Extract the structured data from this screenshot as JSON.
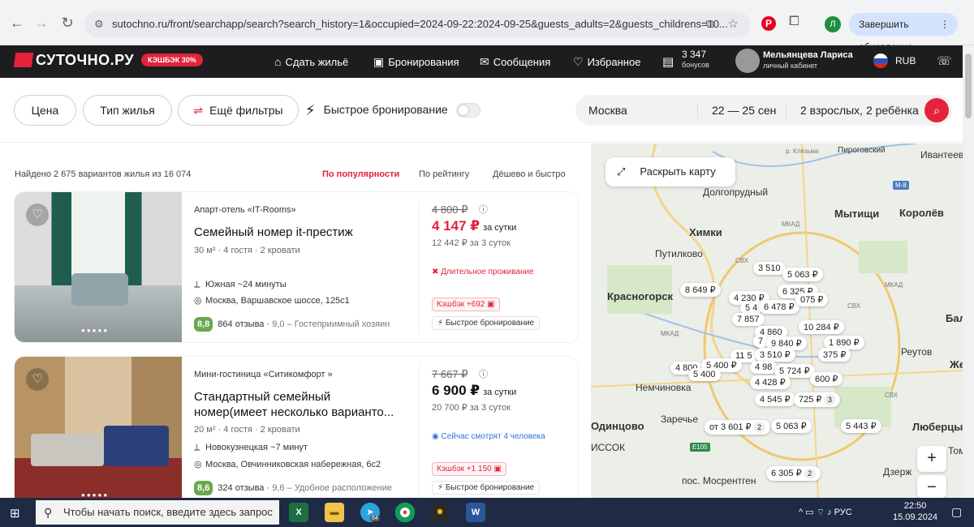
{
  "browser": {
    "url": "sutochno.ru/front/searchapp/search?search_history=1&occupied=2024-09-22:2024-09-25&guests_adults=2&guests_childrens=10...",
    "profile_initial": "Л",
    "update_label": "Завершить обновление"
  },
  "header": {
    "logo": "СУТОЧНО.РУ",
    "cashback_badge": "КЭШБЭК 30%",
    "nav": [
      {
        "label": "Сдать жильё",
        "icon": "house-plus-icon"
      },
      {
        "label": "Бронирования",
        "icon": "bookmark-icon"
      },
      {
        "label": "Сообщения",
        "icon": "chat-icon"
      },
      {
        "label": "Избранное",
        "icon": "heart-shield-icon"
      }
    ],
    "bonus_value": "3 347",
    "bonus_label": "бонусов",
    "user_name": "Мельянцева Лариса",
    "user_sub": "личный кабинет",
    "currency": "RUB"
  },
  "filters": {
    "price": "Цена",
    "housing_type": "Тип жилья",
    "more": "Ещё фильтры",
    "fast_booking": "Быстрое бронирование",
    "fast_booking_on": false,
    "city": "Москва",
    "dates": "22 — 25 сен",
    "guests": "2 взрослых, 2 ребёнка"
  },
  "results": {
    "found": "Найдено 2 675 вариантов жилья из 16 074",
    "sort": [
      "По популярности",
      "По рейтингу",
      "Дёшево и быстро"
    ],
    "active_sort": 0,
    "cards": [
      {
        "type": "Апарт-отель «IT-Rooms»",
        "title": "Семейный номер it-престиж",
        "meta": "30 м²  ·  4 гостя  ·  2 кровати",
        "transit": "Южная ~24 минуты",
        "address": "Москва, Варшавское шоссе, 125с1",
        "score": "8,8",
        "reviews": "864 отзыва",
        "score_text": "9,0 – Гостеприимный хозяин",
        "old_price": "4 800 ₽",
        "price": "4 147 ₽",
        "per": "за сутки",
        "total": "12 442 ₽ за 3 суток",
        "note": "Длительное проживание",
        "note_color": "#e2233b",
        "cashback": "Кэшбэк +692",
        "fast": "Быстрое бронирование"
      },
      {
        "type": "Мини-гостиница «Ситикомфорт »",
        "title": "Стандартный семейный номер(имеет несколько варианто...",
        "meta": "20 м²  ·  4 гостя  ·  2 кровати",
        "transit": "Новокузнецкая ~7 минут",
        "address": "Москва, Овчинниковская набережная, 6с2",
        "score": "8,6",
        "reviews": "324 отзыва",
        "score_text": "9,6 – Удобное расположение",
        "old_price": "7 667 ₽",
        "price": "6 900 ₽",
        "per": "за сутки",
        "total": "20 700 ₽ за 3 суток",
        "note": "Сейчас смотрят 4 человека",
        "note_color": "#2f6fe0",
        "cashback": "Кэшбэк +1 150",
        "fast": "Быстрое бронирование"
      }
    ]
  },
  "map": {
    "expand": "Раскрыть карту",
    "labels": [
      "Долгопрудный",
      "Химки",
      "Мытищи",
      "Королёв",
      "Путилково",
      "Красногорск",
      "Реутов",
      "Немчиновка",
      "Заречье",
      "Одинцово",
      "Люберцы",
      "пос. Мосрентген",
      "Пироговский",
      "Ивантеевка",
      "Бала",
      "Же",
      "Дзерж",
      "ИССОК",
      "Томи"
    ],
    "small_labels": [
      "р. Клязьма",
      "МКАД",
      "МКАД",
      "СВХ",
      "МКАД",
      "СВХ",
      "СВХ",
      "M-8",
      "E105"
    ],
    "prices": [
      "3 510",
      "5 063 ₽",
      "8 649 ₽",
      "4 230 ₽",
      "6 325 ₽",
      "5 4",
      "6 478 ₽",
      "075 ₽",
      "7 857",
      "10 284 ₽",
      "4 860",
      "7",
      "9 840 ₽",
      "1 890 ₽",
      "11 5",
      "3 510 ₽",
      "375 ₽",
      "4 800",
      "5 400 ₽",
      "5 400",
      "4 98",
      "5 724 ₽",
      "600 ₽",
      "4 428 ₽",
      "4 545 ₽",
      "725 ₽",
      "от 3 601 ₽",
      "5 063 ₽",
      "5 443 ₽",
      "6 305 ₽"
    ],
    "cluster_counts": [
      "3",
      "2",
      "2"
    ]
  },
  "taskbar": {
    "search_placeholder": "Чтобы начать поиск, введите здесь запрос",
    "lang": "РУС",
    "time": "22:50",
    "date": "15.09.2024",
    "badge": "64"
  }
}
